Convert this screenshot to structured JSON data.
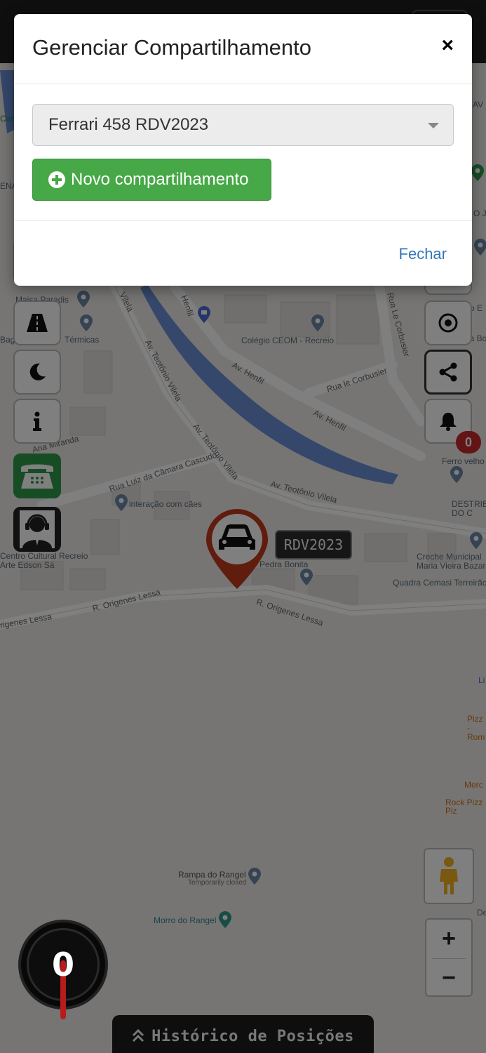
{
  "map": {
    "labels": [
      "Maisa Paradis",
      "Bag pol Sacola",
      "Térmicas",
      "Colégio CEOM - Recreio",
      "Condomínio E",
      "Way Barra Bo",
      "Ferro velho",
      "DESTRIB DO C",
      "interação com cães",
      "Centro Cultural Recreio Arte Edson Sá",
      "Pedra Bonita",
      "Creche Municipal Maria Vieira Bazar",
      "Quadra Cemasi Terreirão",
      "Li",
      "Pizz -Rom",
      "Merc",
      "Rock Pizz Piz",
      "Rampa do Rangel",
      "Temporarily closed",
      "Morro do Rangel",
      "De",
      "AV",
      "Can",
      "ENA",
      "O J"
    ],
    "streets": [
      "Av. Teotônio Vilela",
      "Av. Teotônio Vilela",
      "Av. Teotônio Vilela",
      "Av. Henfil",
      "Av. Henfil",
      "Henfil",
      "Rua Le Corbusier",
      "Rua le Corbusier",
      "Rua Luiz da Câmara Cascudo",
      "R. Origenes Lessa",
      "R. Origenes Lessa",
      "rigenes Lessa",
      "Vilela",
      "Ana Miranda"
    ]
  },
  "controls": {
    "alert_count": "0",
    "speed": "0",
    "history_label": "Histórico de Posições",
    "zoom_in": "+",
    "zoom_out": "−"
  },
  "vehicle": {
    "plate": "RDV2023"
  },
  "modal": {
    "title": "Gerenciar Compartilhamento",
    "close_symbol": "×",
    "select_value": "Ferrari 458 RDV2023",
    "new_share_label": "Novo compartilhamento",
    "close_label": "Fechar"
  },
  "colors": {
    "primary_green": "#46a846",
    "link_blue": "#337ab7",
    "badge_red": "#c62828",
    "marker_red": "#c0391b",
    "river_blue": "#6a8fd6"
  }
}
